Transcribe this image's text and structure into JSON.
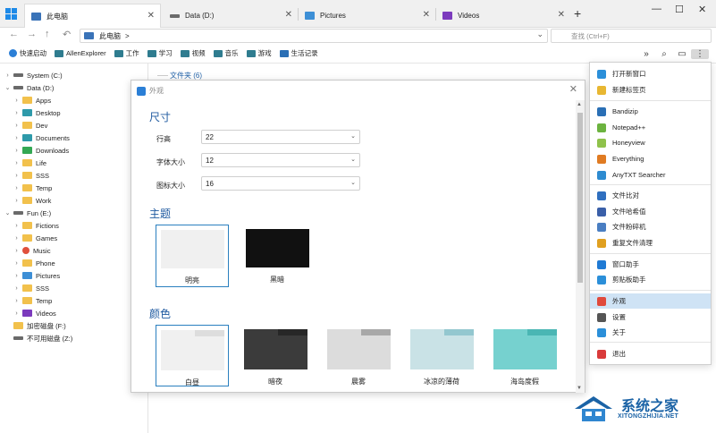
{
  "tabs": [
    {
      "label": "此电脑",
      "color": "#3a73b8"
    },
    {
      "label": "Data (D:)",
      "color": "#6a6a6a"
    },
    {
      "label": "Pictures",
      "color": "#3d8fd6"
    },
    {
      "label": "Videos",
      "color": "#7c3bbd"
    }
  ],
  "window_controls": {
    "minimize": "—",
    "maximize": "☐",
    "close": "✕"
  },
  "address": {
    "path": "此电脑",
    "sep": ">",
    "search_placeholder": "查找 (Ctrl+F)"
  },
  "bookmarks": [
    "快速启动",
    "AllenExplorer",
    "工作",
    "学习",
    "视频",
    "音乐",
    "游戏",
    "生活记录"
  ],
  "tree": [
    {
      "label": "System (C:)",
      "level": 0,
      "arrow": "›",
      "icon": "drive"
    },
    {
      "label": "Data (D:)",
      "level": 0,
      "arrow": "⌄",
      "icon": "drive"
    },
    {
      "label": "Apps",
      "level": 1,
      "arrow": "›",
      "icon": "folder"
    },
    {
      "label": "Desktop",
      "level": 1,
      "arrow": "›",
      "icon": "teal"
    },
    {
      "label": "Dev",
      "level": 1,
      "arrow": "›",
      "icon": "folder"
    },
    {
      "label": "Documents",
      "level": 1,
      "arrow": "›",
      "icon": "teal"
    },
    {
      "label": "Downloads",
      "level": 1,
      "arrow": "›",
      "icon": "green"
    },
    {
      "label": "Life",
      "level": 1,
      "arrow": "›",
      "icon": "folder"
    },
    {
      "label": "SSS",
      "level": 1,
      "arrow": "›",
      "icon": "folder"
    },
    {
      "label": "Temp",
      "level": 1,
      "arrow": "›",
      "icon": "folder"
    },
    {
      "label": "Work",
      "level": 1,
      "arrow": "›",
      "icon": "folder"
    },
    {
      "label": "Fun (E:)",
      "level": 0,
      "arrow": "⌄",
      "icon": "drive"
    },
    {
      "label": "Fictions",
      "level": 1,
      "arrow": "›",
      "icon": "folder"
    },
    {
      "label": "Games",
      "level": 1,
      "arrow": "›",
      "icon": "folder"
    },
    {
      "label": "Music",
      "level": 1,
      "arrow": "›",
      "icon": "red"
    },
    {
      "label": "Phone",
      "level": 1,
      "arrow": "›",
      "icon": "folder"
    },
    {
      "label": "Pictures",
      "level": 1,
      "arrow": "›",
      "icon": "blue"
    },
    {
      "label": "SSS",
      "level": 1,
      "arrow": "›",
      "icon": "folder"
    },
    {
      "label": "Temp",
      "level": 1,
      "arrow": "›",
      "icon": "folder"
    },
    {
      "label": "Videos",
      "level": 1,
      "arrow": "›",
      "icon": "purple"
    },
    {
      "label": "加密磁盘 (F:)",
      "level": 0,
      "arrow": "",
      "icon": "folder"
    },
    {
      "label": "不可用磁盘 (Z:)",
      "level": 0,
      "arrow": "",
      "icon": "drive"
    }
  ],
  "content": {
    "group_title": "文件夹 (6)"
  },
  "dialog": {
    "title": "外观",
    "close": "✕",
    "size_section": "尺寸",
    "fields": [
      {
        "label": "行高",
        "value": "22"
      },
      {
        "label": "字体大小",
        "value": "12"
      },
      {
        "label": "图标大小",
        "value": "16"
      }
    ],
    "theme_section": "主题",
    "themes": [
      {
        "label": "明亮",
        "color": "#f0f0f0",
        "selected": true
      },
      {
        "label": "黑暗",
        "color": "#111111",
        "selected": false
      }
    ],
    "color_section": "颜色",
    "colors": [
      {
        "label": "白昼",
        "body": "#f0f0f0",
        "strip": "#dddddd",
        "tab": "#f0f0f0",
        "selected": true
      },
      {
        "label": "暗夜",
        "body": "#3b3b3b",
        "strip": "#272727",
        "tab": "#3b3b3b",
        "selected": false
      },
      {
        "label": "晨雾",
        "body": "#dcdcdc",
        "strip": "#a8a8a8",
        "tab": "#dcdcdc",
        "selected": false
      },
      {
        "label": "冰凉的薄荷",
        "body": "#c9e2e6",
        "strip": "#93c7cf",
        "tab": "#c9e2e6",
        "selected": false
      },
      {
        "label": "海岛度假",
        "body": "#76d1cf",
        "strip": "#4ab6b4",
        "tab": "#76d1cf",
        "selected": false
      }
    ]
  },
  "menu": {
    "items": [
      {
        "label": "打开新窗口",
        "color": "#2b8fd9"
      },
      {
        "label": "新建标签页",
        "color": "#e8b732"
      },
      {
        "label": "Bandizip",
        "color": "#2a6fb5"
      },
      {
        "label": "Notepad++",
        "color": "#6cb33f"
      },
      {
        "label": "Honeyview",
        "color": "#8fc24b"
      },
      {
        "label": "Everything",
        "color": "#e07b22"
      },
      {
        "label": "AnyTXT Searcher",
        "color": "#2e8bd0"
      },
      {
        "label": "文件比对",
        "color": "#2f6fbf"
      },
      {
        "label": "文件哈希值",
        "color": "#3a5fa8"
      },
      {
        "label": "文件粉碎机",
        "color": "#4a7ec2"
      },
      {
        "label": "重复文件清理",
        "color": "#e0a020"
      },
      {
        "label": "窗口助手",
        "color": "#1f7ad4"
      },
      {
        "label": "剪贴板助手",
        "color": "#2b8fd9"
      },
      {
        "label": "外观",
        "color": "#e04a3c"
      },
      {
        "label": "设置",
        "color": "#555555"
      },
      {
        "label": "关于",
        "color": "#2b8fd9"
      },
      {
        "label": "退出",
        "color": "#d93a3a"
      }
    ],
    "highlighted": "外观"
  },
  "watermark": {
    "text": "系统之家",
    "url": "XITONGZHIJIA.NET"
  }
}
